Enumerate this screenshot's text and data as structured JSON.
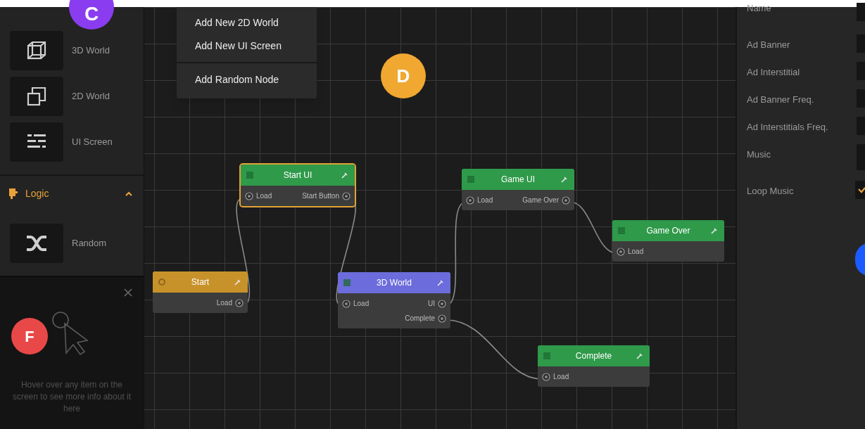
{
  "sidebar": {
    "marker": {
      "label": "C",
      "color": "#8a3df0"
    },
    "items": [
      {
        "label": "3D World",
        "kind": "cube"
      },
      {
        "label": "2D World",
        "kind": "squares"
      },
      {
        "label": "UI Screen",
        "kind": "lines"
      }
    ],
    "sections": [
      {
        "title": "Logic",
        "expanded": true,
        "items": [
          {
            "label": "Random",
            "kind": "shuffle"
          }
        ]
      }
    ]
  },
  "help": {
    "marker": {
      "label": "F",
      "color": "#e84848"
    },
    "text": "Hover over any item on the screen to see more info about it here"
  },
  "menu": {
    "groups": [
      [
        "Add New 2D World",
        "Add New UI Screen"
      ],
      [
        "Add Random Node"
      ]
    ]
  },
  "canvas": {
    "marker": {
      "label": "D",
      "color": "#f0a830"
    },
    "nodes": [
      {
        "title": "Start UI",
        "kind": "screen",
        "selected": true,
        "ports": [
          {
            "input": "Load",
            "output": "Start Button"
          }
        ]
      },
      {
        "title": "Start",
        "kind": "start",
        "selected": false,
        "ports": [
          {
            "output": "Load"
          }
        ]
      },
      {
        "title": "3D World",
        "kind": "world",
        "selected": false,
        "ports": [
          {
            "input": "Load",
            "output": "UI"
          },
          {
            "output": "Complete"
          }
        ]
      },
      {
        "title": "Game UI",
        "kind": "screen",
        "selected": false,
        "ports": [
          {
            "input": "Load",
            "output": "Game Over"
          }
        ]
      },
      {
        "title": "Game Over",
        "kind": "screen",
        "selected": false,
        "ports": [
          {
            "input": "Load"
          }
        ]
      },
      {
        "title": "Complete",
        "kind": "screen",
        "selected": false,
        "ports": [
          {
            "input": "Load"
          }
        ]
      }
    ]
  },
  "properties": {
    "marker": {
      "color": "#1a5cff"
    },
    "fields": [
      {
        "label": "Name",
        "kind": "text"
      },
      {
        "label": "Ad Banner",
        "kind": "text"
      },
      {
        "label": "Ad Interstitial",
        "kind": "text"
      },
      {
        "label": "Ad Banner Freq.",
        "kind": "text"
      },
      {
        "label": "Ad Interstitials Freq.",
        "kind": "text"
      },
      {
        "label": "Music",
        "kind": "tall"
      },
      {
        "label": "Loop Music",
        "kind": "checkbox",
        "checked": true
      }
    ]
  }
}
